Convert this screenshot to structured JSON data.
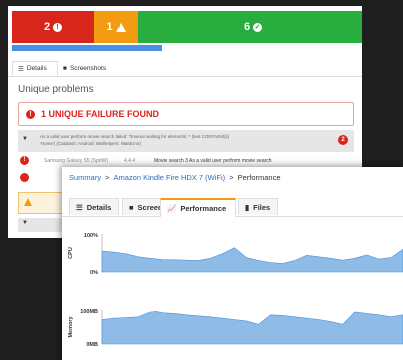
{
  "summary": {
    "failed_count": "2",
    "warning_count": "1",
    "passed_count": "6",
    "colors": {
      "failed": "#d9261c",
      "warning": "#f39c12",
      "passed": "#27ae3e",
      "progress": "#4a90e2"
    }
  },
  "progress_fraction": 0.42,
  "back_tabs": [
    {
      "label": "Details",
      "icon": "list-icon"
    },
    {
      "label": "Screenshots",
      "icon": "camera-icon"
    }
  ],
  "unique_problems_heading": "Unique problems",
  "failure_box_text": "1 UNIQUE FAILURE FOUND",
  "problem": {
    "line1": "As a valid user perform movie search failed: Timeout waiting for elements: * (text CONTAINS[c]",
    "line2": "'Home') (Catalash: Android: Walhelpers: WaitError)",
    "count": "2"
  },
  "device_row": {
    "device": "Samsung Galaxy S5 (SprtW)",
    "version": "4.4.4",
    "test": "Movie search 3 As a valid user perform movie search"
  },
  "breadcrumb": {
    "root": "Summary",
    "device": "Amazon Kindle Fire HDX 7 (WiFi)",
    "current": "Performance",
    "separator": ">"
  },
  "front_tabs": [
    {
      "label": "Details",
      "icon": "list-icon"
    },
    {
      "label": "Screenshots",
      "icon": "camera-icon"
    },
    {
      "label": "Performance",
      "icon": "chart-icon",
      "active": true
    },
    {
      "label": "Files",
      "icon": "file-icon"
    }
  ],
  "chart_data": [
    {
      "type": "area",
      "ylabel": "CPU",
      "ylim_labels": [
        "100%",
        "0%"
      ],
      "ylim": [
        0,
        100
      ],
      "x": [
        0,
        4,
        8,
        12,
        16,
        20,
        24,
        28,
        32,
        36,
        40,
        44,
        48,
        52,
        56,
        60,
        64,
        68,
        72,
        76,
        80,
        84,
        88,
        92,
        96,
        100
      ],
      "values": [
        55,
        52,
        48,
        40,
        36,
        33,
        32,
        31,
        30,
        36,
        48,
        64,
        38,
        30,
        25,
        22,
        30,
        44,
        40,
        36,
        31,
        36,
        45,
        34,
        38,
        60
      ],
      "color": "#8fbce6"
    },
    {
      "type": "area",
      "ylabel": "Memory",
      "ylim_labels": [
        "100MB",
        "0MB"
      ],
      "ylim": [
        0,
        100
      ],
      "x": [
        0,
        4,
        8,
        12,
        16,
        18,
        20,
        24,
        28,
        32,
        36,
        40,
        44,
        48,
        52,
        56,
        60,
        64,
        68,
        72,
        76,
        80,
        84,
        88,
        92,
        96,
        100
      ],
      "values": [
        72,
        76,
        78,
        80,
        94,
        96,
        92,
        90,
        86,
        83,
        80,
        76,
        72,
        68,
        58,
        86,
        84,
        80,
        76,
        72,
        66,
        58,
        94,
        90,
        86,
        80,
        86
      ],
      "color": "#8fbce6"
    }
  ]
}
